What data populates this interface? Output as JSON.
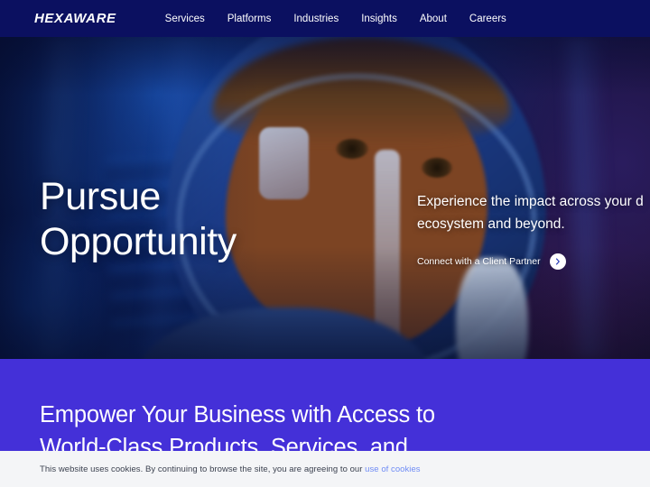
{
  "colors": {
    "nav_bg": "#0b1060",
    "purple_section": "#4430d8",
    "cookie_bg": "#f4f5f7",
    "cookie_link": "#6f8cf5",
    "text_light": "#ffffff"
  },
  "navbar": {
    "logo": "HEXAWARE",
    "links": [
      {
        "label": "Services"
      },
      {
        "label": "Platforms"
      },
      {
        "label": "Industries"
      },
      {
        "label": "Insights"
      },
      {
        "label": "About"
      },
      {
        "label": "Careers"
      }
    ]
  },
  "hero": {
    "heading_line1": "Pursue",
    "heading_line2": "Opportunity",
    "subheading_line1": "Experience the impact across your d",
    "subheading_line2": "ecosystem and beyond.",
    "cta_label": "Connect with a Client Partner",
    "cta_icon": "chevron-right-icon",
    "scroll_icon": "chevron-down-icon"
  },
  "promo": {
    "heading_line1": "Empower Your Business with Access to",
    "heading_line2": "World-Class Products, Services, and"
  },
  "cookie": {
    "text": "This website uses cookies. By continuing to browse the site, you are agreeing to our ",
    "link_label": "use of cookies"
  }
}
